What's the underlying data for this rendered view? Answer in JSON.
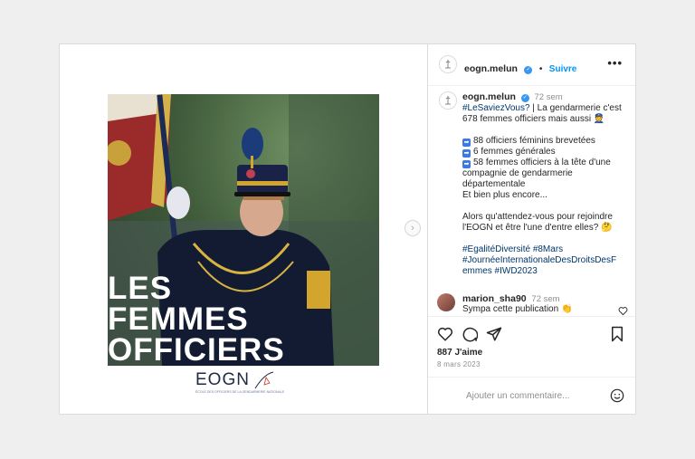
{
  "post": {
    "image": {
      "overlay_lines": [
        "LES",
        "FEMMES",
        "OFFICIERS"
      ],
      "logo_text": "EOGN",
      "logo_subtitle": "ÉCOLE DES OFFICIERS DE LA GENDARMERIE NATIONALE"
    }
  },
  "header": {
    "username": "eogn.melun",
    "follow_label": "Suivre",
    "more_icon": "more-dots-icon"
  },
  "caption": {
    "username": "eogn.melun",
    "time": "72 sem",
    "lines": [
      {
        "hashtag": "#LeSaviezVous?",
        "text": " | La gendarmerie c'est"
      },
      {
        "text": "678 femmes officiers mais aussi 👮"
      },
      {
        "text": ""
      },
      {
        "icon": "➡",
        "text": "88 officiers féminins brevetées"
      },
      {
        "icon": "➡",
        "text": "6 femmes générales"
      },
      {
        "icon": "➡",
        "text": "58 femmes officiers à la tête d'une"
      },
      {
        "text": "compagnie de gendarmerie"
      },
      {
        "text": "départementale"
      },
      {
        "text": "Et bien plus encore..."
      },
      {
        "text": ""
      },
      {
        "text": "Alors qu'attendez-vous pour rejoindre"
      },
      {
        "text": "l'EOGN et être l'une d'entre elles? 🤔"
      },
      {
        "text": ""
      },
      {
        "hashtag": "#EgalitéDiversité #8Mars"
      },
      {
        "hashtag": "#JournéeInternationaleDesDroitsDesF"
      },
      {
        "hashtag": "emmes #IWD2023"
      }
    ]
  },
  "comment": {
    "username": "marion_sha90",
    "time": "72 sem",
    "text": "Sympa cette publication 👏"
  },
  "actions": {
    "likes": "887 J'aime",
    "date": "8 mars 2023",
    "add_comment_placeholder": "Ajouter un commentaire...",
    "icons": [
      "heart-icon",
      "comment-icon",
      "share-icon",
      "bookmark-icon",
      "emoji-icon"
    ]
  }
}
